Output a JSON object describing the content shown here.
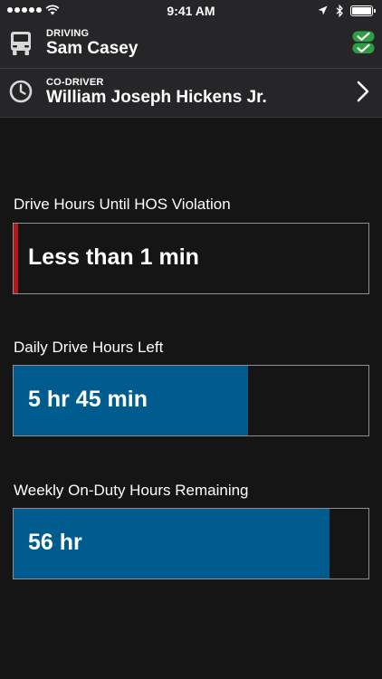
{
  "status_bar": {
    "time": "9:41 AM"
  },
  "driver": {
    "caption": "DRIVING",
    "name": "Sam Casey",
    "icon": "truck-icon",
    "status_icon": "double-check-icon",
    "status_color": "#2e9e44"
  },
  "co_driver": {
    "caption": "CO-DRIVER",
    "name": "William Joseph Hickens Jr.",
    "icon": "clock-icon"
  },
  "metrics": [
    {
      "label": "Drive Hours Until HOS Violation",
      "value": "Less than 1 min",
      "alert": true,
      "alert_color": "#b3151b"
    },
    {
      "label": "Daily Drive Hours Left",
      "value": "5 hr 45 min",
      "fraction_filled": 0.66,
      "fill_color": "#005b8f"
    },
    {
      "label": "Weekly On-Duty Hours Remaining",
      "value": "56 hr",
      "fraction_filled": 0.89,
      "fill_color": "#005b8f"
    }
  ]
}
